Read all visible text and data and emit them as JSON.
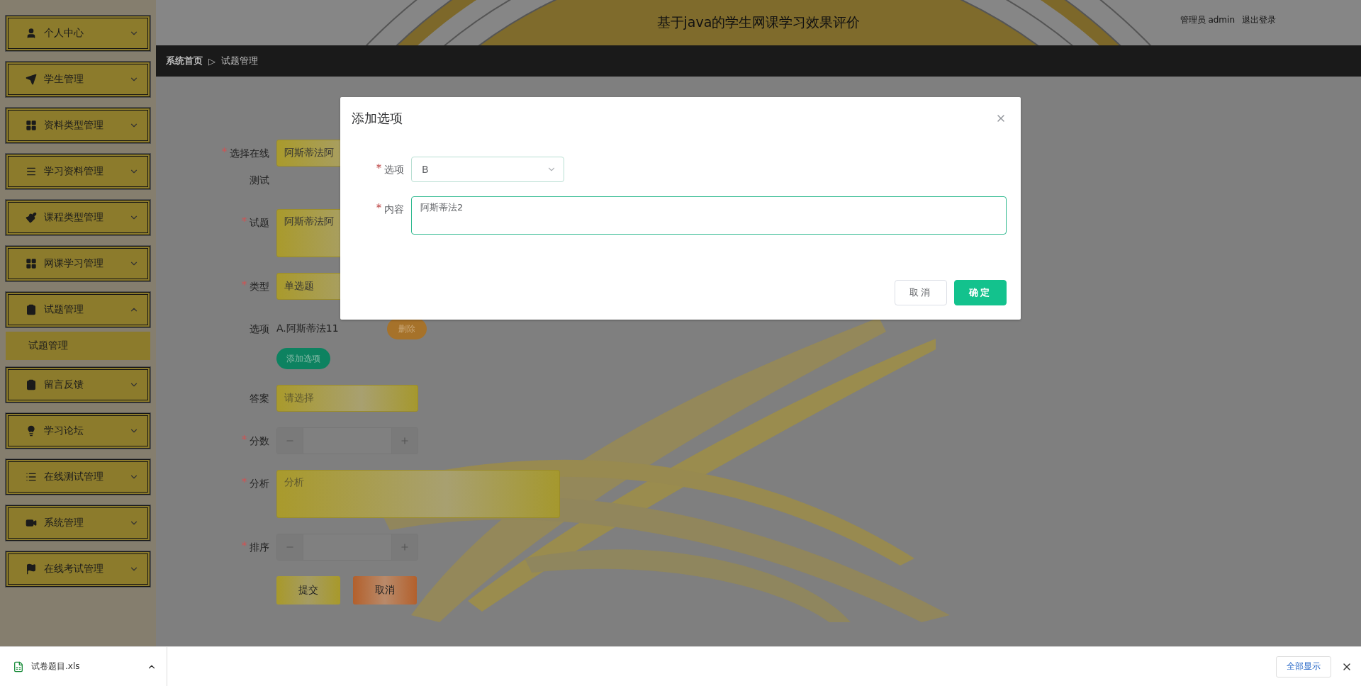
{
  "header": {
    "title": "基于java的学生网课学习效果评价",
    "user": "管理员 admin",
    "logout": "退出登录"
  },
  "breadcrumb": {
    "home": "系统首页",
    "separator": "▷",
    "current": "试题管理"
  },
  "sidebar": {
    "items": [
      {
        "label": "个人中心",
        "expanded": false
      },
      {
        "label": "学生管理",
        "expanded": false
      },
      {
        "label": "资料类型管理",
        "expanded": false
      },
      {
        "label": "学习资料管理",
        "expanded": false
      },
      {
        "label": "课程类型管理",
        "expanded": false
      },
      {
        "label": "网课学习管理",
        "expanded": false
      },
      {
        "label": "试题管理",
        "expanded": true,
        "children": [
          {
            "label": "试题管理"
          }
        ]
      },
      {
        "label": "留言反馈",
        "expanded": false
      },
      {
        "label": "学习论坛",
        "expanded": false
      },
      {
        "label": "在线测试管理",
        "expanded": false
      },
      {
        "label": "系统管理",
        "expanded": false
      },
      {
        "label": "在线考试管理",
        "expanded": false
      }
    ]
  },
  "form": {
    "fields": [
      {
        "kind": "select",
        "label": "选择在线测试",
        "required": true,
        "value": "阿斯蒂法阿"
      },
      {
        "kind": "textarea",
        "label": "试题",
        "required": true,
        "value": "阿斯蒂法阿"
      },
      {
        "kind": "select",
        "label": "类型",
        "required": true,
        "value": "单选题"
      },
      {
        "kind": "options",
        "label": "选项",
        "required": false,
        "items": [
          {
            "text": "A.阿斯蒂法11",
            "action": "删除"
          }
        ],
        "add_button": "添加选项"
      },
      {
        "kind": "select",
        "label": "答案",
        "required": false,
        "placeholder": "请选择"
      },
      {
        "kind": "number",
        "label": "分数",
        "required": true
      },
      {
        "kind": "textarea",
        "label": "分析",
        "required": true,
        "placeholder": "分析"
      },
      {
        "kind": "number",
        "label": "排序",
        "required": true
      }
    ],
    "buttons": [
      {
        "label": "提交",
        "kind": "submit"
      },
      {
        "label": "取消",
        "kind": "cancel"
      }
    ]
  },
  "dialog": {
    "title": "添加选项",
    "fields": [
      {
        "kind": "select",
        "label": "选项",
        "required": true,
        "value": "B",
        "focused": false
      },
      {
        "kind": "textarea",
        "label": "内容",
        "required": true,
        "value": "阿斯蒂法2",
        "focused": true
      }
    ],
    "buttons": [
      {
        "label": "取消",
        "kind": "default"
      },
      {
        "label": "确定",
        "kind": "primary"
      }
    ]
  },
  "download_bar": {
    "file": "试卷题目.xls",
    "show_all": "全部显示"
  }
}
